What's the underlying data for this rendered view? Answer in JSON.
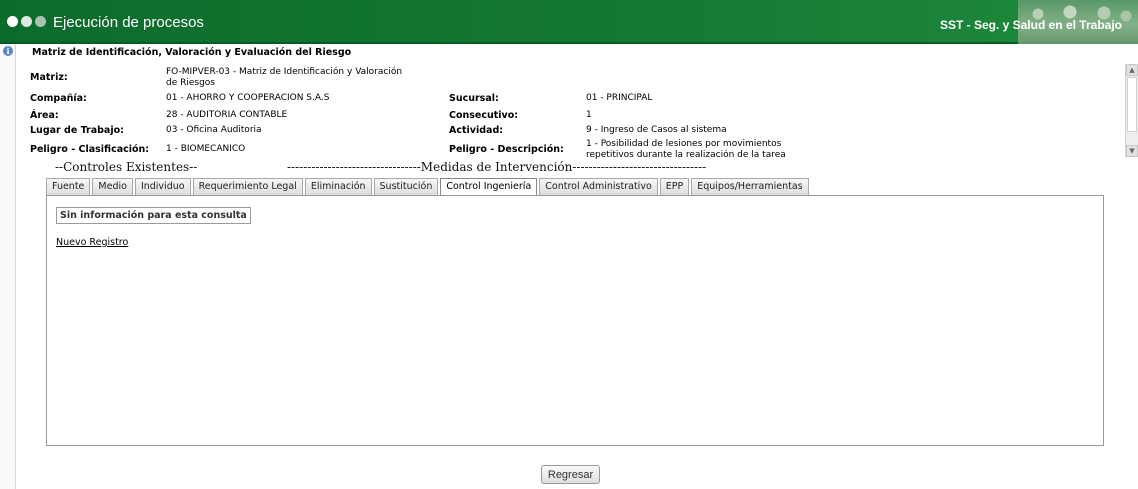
{
  "header": {
    "title": "Ejecución de procesos",
    "brand": "SST - Seg. y Salud en el Trabajo"
  },
  "section": {
    "title": "Matriz de Identificación, Valoración y Evaluación del Riesgo"
  },
  "fields": {
    "matriz": {
      "label": "Matriz:",
      "value": "FO-MIPVER-03 - Matriz de Identificación y Valoración de Riesgos"
    },
    "compania": {
      "label": "Compañía:",
      "value": "01 - AHORRO Y COOPERACION S.A.S"
    },
    "sucursal": {
      "label": "Sucursal:",
      "value": "01 - PRINCIPAL"
    },
    "area": {
      "label": "Área:",
      "value": "28 - AUDITORIA CONTABLE"
    },
    "consecutivo": {
      "label": "Consecutivo:",
      "value": "1"
    },
    "lugar": {
      "label": "Lugar de Trabajo:",
      "value": "03 - Oficina Auditoria"
    },
    "actividad": {
      "label": "Actividad:",
      "value": "9 - Ingreso de Casos al sistema"
    },
    "peligro_clas": {
      "label": "Peligro - Clasificación:",
      "value": "1 - BIOMECANICO"
    },
    "peligro_desc": {
      "label": "Peligro - Descripción:",
      "value": "1 - Posibilidad de lesiones por movimientos repetitivos durante la realización de la tarea"
    }
  },
  "separator": {
    "controles": "--Controles Existentes--",
    "medidas": "---------------------------------Medidas de Intervención---------------------------------"
  },
  "tabs": [
    {
      "label": "Fuente"
    },
    {
      "label": "Medio"
    },
    {
      "label": "Individuo"
    },
    {
      "label": "Requerimiento Legal"
    },
    {
      "label": "Eliminación"
    },
    {
      "label": "Sustitución"
    },
    {
      "label": "Control Ingeniería",
      "active": true
    },
    {
      "label": "Control Administrativo"
    },
    {
      "label": "EPP"
    },
    {
      "label": "Equipos/Herramientas"
    }
  ],
  "panel": {
    "no_info": "Sin información para esta consulta",
    "new_record": "Nuevo Registro"
  },
  "actions": {
    "back": "Regresar"
  },
  "icons": {
    "window_dots": "three-dots-icon",
    "info": "info-icon",
    "scroll_up": "arrow-up-icon",
    "scroll_down": "arrow-down-icon"
  },
  "colors": {
    "header_green": "#167a33",
    "tab_active": "#ffffff"
  }
}
